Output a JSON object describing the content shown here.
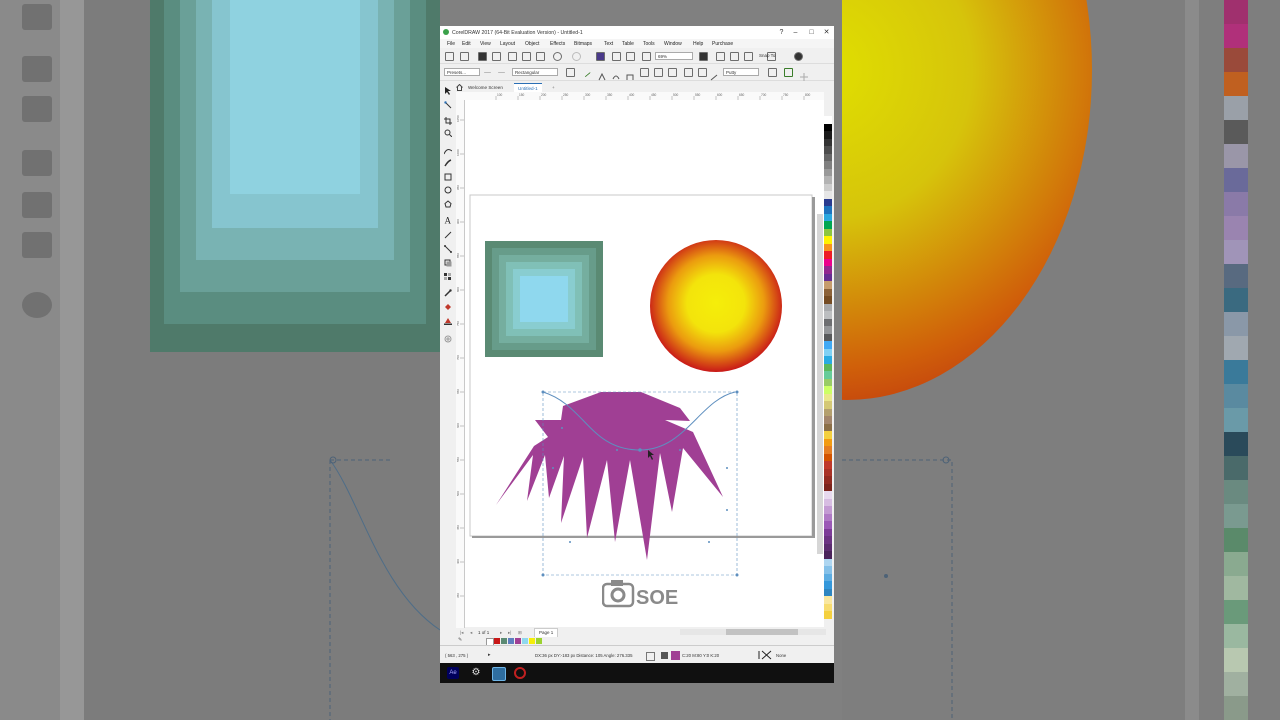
{
  "window": {
    "title": "CorelDRAW 2017 (64-Bit Evaluation Version) - Untitled-1",
    "minimize": "–",
    "maximize": "□",
    "close": "✕"
  },
  "menu": [
    "File",
    "Edit",
    "View",
    "Layout",
    "Object",
    "Effects",
    "Bitmaps",
    "Text",
    "Table",
    "Tools",
    "Window",
    "Help",
    "Purchase"
  ],
  "toolbar": {
    "zoom_value": "69%",
    "snap_to": "Snap To",
    "presets": "Presets...",
    "envelope_mode": "Rectangular",
    "mapping_mode": "Putty"
  },
  "tabs": [
    "Welcome Screen",
    "Untitled-1"
  ],
  "add_tab": "+",
  "ruler": {
    "h_ticks": [
      "100",
      "150",
      "200",
      "250",
      "300",
      "350",
      "400",
      "450",
      "500",
      "550",
      "600",
      "650",
      "700",
      "750",
      "800"
    ],
    "v_ticks": [
      "1050",
      "1000",
      "950",
      "900",
      "850",
      "800",
      "750",
      "700",
      "650",
      "600",
      "550",
      "500",
      "450",
      "400",
      "350"
    ]
  },
  "page_nav": {
    "position": "1 of 1",
    "page_tab": "Page 1"
  },
  "status": {
    "cursor": "( 563 , 275 )",
    "info": "DX:36 px DY:-183 px Distance: 105 Angle: 276.335",
    "fill": "C:20 M:80 Y:0 K:20",
    "outline": "None"
  },
  "colors": {
    "accent": "#a03f94",
    "square_outer": "#5a8a73",
    "square_inner": "#8fd8ee",
    "sun_center": "#f5ee0a",
    "sun_edge": "#c81818",
    "selection": "#5e8fbf"
  },
  "icons": {
    "title_logo": "coreldraw-logo-icon",
    "taskbar": [
      "after-effects-icon",
      "settings-gear-icon",
      "desktop-icon",
      "record-icon"
    ]
  },
  "watermark": "SOE"
}
